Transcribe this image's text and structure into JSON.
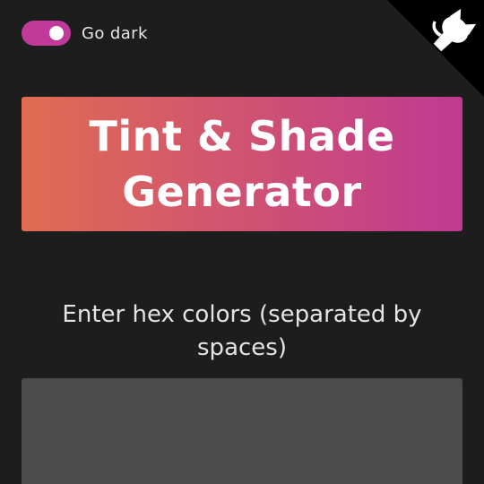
{
  "theme_toggle": {
    "label": "Go dark",
    "state": "on",
    "track_color": "#c13a9a",
    "knob_color": "#ffffff"
  },
  "github_corner": {
    "icon": "github-octocat-icon",
    "background_color": "#000000",
    "icon_color": "#ffffff"
  },
  "header": {
    "title_line_1": "Tint & Shade",
    "title_line_2": "Generator",
    "gradient_start": "#e06c52",
    "gradient_end": "#bf3a91"
  },
  "form": {
    "prompt_line_1": "Enter hex colors (separated by",
    "prompt_line_2": "spaces)",
    "input_value": "",
    "input_background": "#4b4b4b"
  },
  "colors": {
    "page_background": "#1d1d1d",
    "text": "#e4e4e4"
  }
}
